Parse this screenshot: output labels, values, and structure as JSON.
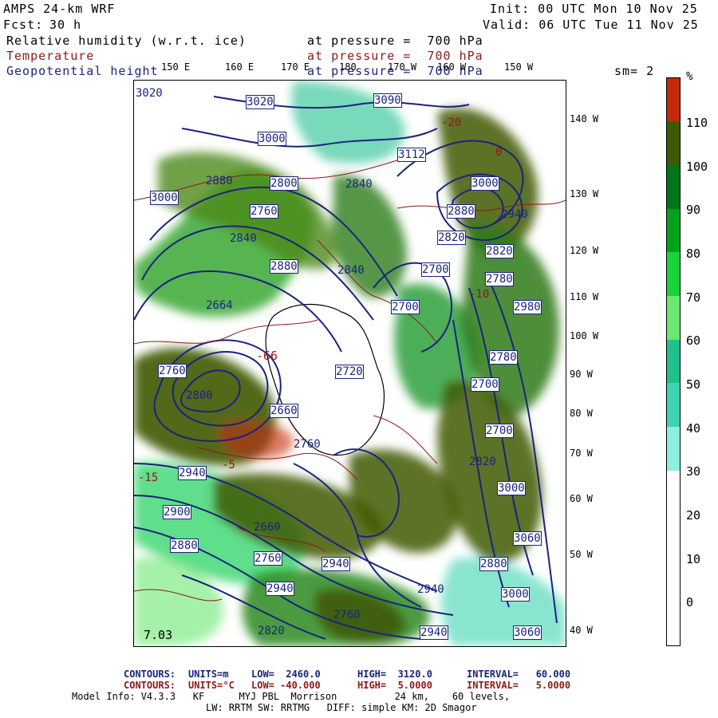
{
  "header": {
    "model": "AMPS 24-km WRF",
    "forecast_label": "Fcst:",
    "forecast_hours": "30 h",
    "init": "Init: 00 UTC Mon 10 Nov 25",
    "valid": "Valid: 06 UTC Tue 11 Nov 25",
    "fields": [
      {
        "name": "Relative humidity (w.r.t. ice)",
        "level": "at pressure =  700 hPa",
        "color": "#000000"
      },
      {
        "name": "Temperature",
        "level": "at pressure =  700 hPa",
        "color": "#8b1a1a"
      },
      {
        "name": "Geopotential height",
        "level": "at pressure =  700 hPa",
        "color": "#1a237e"
      }
    ],
    "smoothing": "sm= 2"
  },
  "top_longitudes": [
    "150 E",
    "160 E",
    "170 E",
    "180",
    "170 W",
    "160 W",
    "150 W"
  ],
  "right_longitudes": [
    "140 W",
    "130 W",
    "120 W",
    "110 W",
    "100 W",
    "90 W",
    "80 W",
    "70 W",
    "60 W",
    "50 W",
    "40 W"
  ],
  "height_labels": [
    "3020",
    "3090",
    "3000",
    "3112",
    "3000",
    "2880",
    "2800",
    "2840",
    "3000",
    "2760",
    "2880",
    "2940",
    "2840",
    "2820",
    "2820",
    "2880",
    "2700",
    "2780",
    "2700",
    "2664",
    "2840",
    "2980",
    "2780",
    "2760",
    "2720",
    "2700",
    "2660",
    "2800",
    "2760",
    "2700",
    "2940",
    "2820",
    "2900",
    "2880",
    "3000",
    "2660",
    "2760",
    "3060",
    "2940",
    "2880",
    "2940",
    "2940",
    "3000",
    "2940",
    "3060",
    "2760",
    "2820"
  ],
  "temperature_labels": [
    "-66",
    "-15",
    "-5",
    "-20",
    "-10",
    "0"
  ],
  "colorbar": {
    "unit": "%",
    "ticks": [
      "110",
      "100",
      "90",
      "80",
      "70",
      "60",
      "50",
      "40",
      "30",
      "20",
      "10",
      "0"
    ],
    "colors": [
      "#c42a0a",
      "#3f5a07",
      "#00761a",
      "#00a21c",
      "#18d43a",
      "#6ae870",
      "#20c08e",
      "#3ed3b1",
      "#8cf0dc",
      "#ffffff",
      "#ffffff",
      "#ffffff",
      "#ffffff"
    ]
  },
  "footer": {
    "contours_height": {
      "label": "CONTOURS:",
      "units": "UNITS=m",
      "low": "LOW=  2460.0",
      "high": "HIGH=  3120.0",
      "interval": "INTERVAL=   60.000"
    },
    "contours_temp": {
      "label": "CONTOURS:",
      "units": "UNITS=°C",
      "low": "LOW= -40.000",
      "high": "HIGH=  5.0000",
      "interval": "INTERVAL=   5.0000"
    },
    "model_info_1": "Model Info: V4.3.3   KF      MYJ PBL  Morrison          24 km,    60 levels,",
    "model_info_2": "LW: RRTM SW: RRTMG   DIFF: simple KM: 2D Smagor"
  },
  "lower_left_label": "7.03"
}
